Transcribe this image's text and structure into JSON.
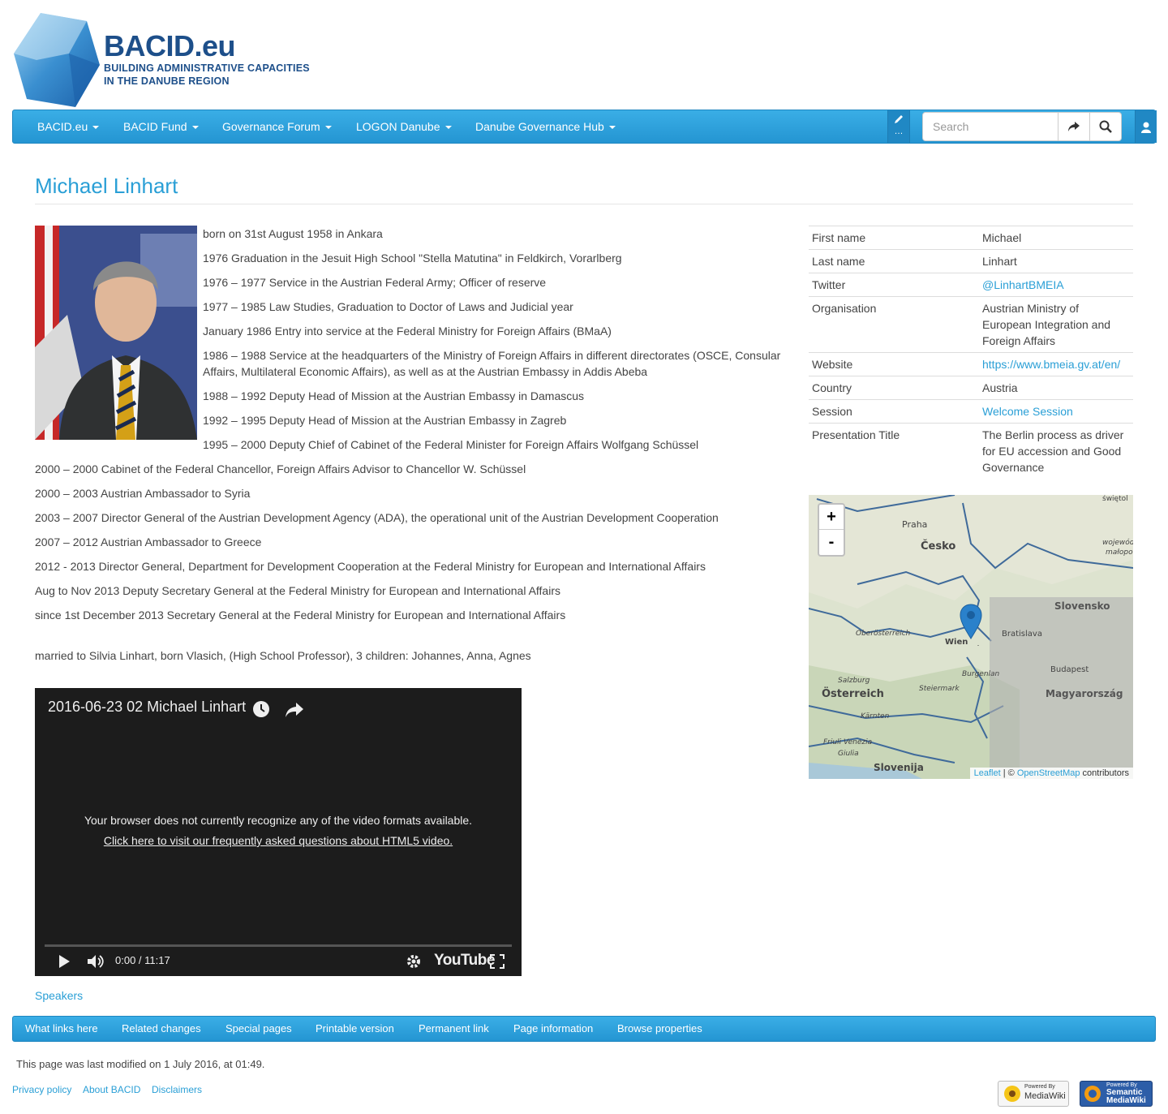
{
  "logo": {
    "brand": "BACID.eu",
    "tagline_1": "BUILDING ADMINISTRATIVE CAPACITIES",
    "tagline_2": "IN THE DANUBE REGION"
  },
  "nav": {
    "items": [
      {
        "label": "BACID.eu"
      },
      {
        "label": "BACID Fund"
      },
      {
        "label": "Governance Forum"
      },
      {
        "label": "LOGON Danube"
      },
      {
        "label": "Danube Governance Hub"
      }
    ],
    "edit_more": "…",
    "search_placeholder": "Search"
  },
  "page": {
    "title": "Michael Linhart"
  },
  "bio": [
    "born on 31st August 1958 in Ankara",
    "1976 Graduation in the Jesuit High School \"Stella Matutina\" in Feldkirch, Vorarlberg",
    "1976 – 1977 Service in the Austrian Federal Army; Officer of reserve",
    "1977 – 1985 Law Studies, Graduation to Doctor of Laws and Judicial year",
    "January 1986 Entry into service at the Federal Ministry for Foreign Affairs (BMaA)",
    "1986 – 1988 Service at the headquarters of the Ministry of Foreign Affairs in different directorates (OSCE, Consular Affairs, Multilateral Economic Affairs), as well as at the Austrian Embassy in Addis Abeba",
    "1988 – 1992 Deputy Head of Mission at the Austrian Embassy in Damascus",
    "1992 – 1995 Deputy Head of Mission at the Austrian Embassy in Zagreb",
    "1995 – 2000 Deputy Chief of Cabinet of the Federal Minister for Foreign Affairs Wolfgang Schüssel",
    "2000 – 2000 Cabinet of the Federal Chancellor, Foreign Affairs Advisor to Chancellor W. Schüssel",
    "2000 – 2003 Austrian Ambassador to Syria",
    "2003 – 2007 Director General of the Austrian Development Agency (ADA), the operational unit of the Austrian Development Cooperation",
    "2007 – 2012 Austrian Ambassador to Greece",
    "2012 - 2013 Director General, Department for Development Cooperation at the Federal Ministry for European and International Affairs",
    "Aug to Nov 2013 Deputy Secretary General at the Federal Ministry for European and International Affairs",
    "since 1st December 2013 Secretary General at the Federal Ministry for European and International Affairs",
    "married to Silvia Linhart, born Vlasich, (High School Professor), 3 children: Johannes, Anna, Agnes"
  ],
  "infobox": {
    "first_name_label": "First name",
    "first_name": "Michael",
    "last_name_label": "Last name",
    "last_name": "Linhart",
    "twitter_label": "Twitter",
    "twitter": "@LinhartBMEIA",
    "organisation_label": "Organisation",
    "organisation": "Austrian Ministry of European Integration and Foreign Affairs",
    "website_label": "Website",
    "website": "https://www.bmeia.gv.at/en/",
    "country_label": "Country",
    "country": "Austria",
    "session_label": "Session",
    "session": "Welcome Session",
    "presentation_label": "Presentation Title",
    "presentation": "The Berlin process as driver for EU accession and Good Governance"
  },
  "map": {
    "zoom_in": "+",
    "zoom_out": "-",
    "labels": {
      "praha": "Praha",
      "cesko": "Česko",
      "slovensko": "Slovensko",
      "bratislava": "Bratislava",
      "wien": "Wien",
      "oberosterreich": "Oberösterreich",
      "salzburg": "Salzburg",
      "osterreich": "Österreich",
      "steiermark": "Steiermark",
      "burgenland": "Burgenlan",
      "budapest": "Budapest",
      "magyarorszag": "Magyarország",
      "karnten": "Kärnten",
      "friuli": "Friuli Venezia",
      "giulia": "Giulia",
      "slovenija": "Slovenija",
      "swieto": "świętol",
      "wojewodz": "województ",
      "malopolsk": "małopolsk"
    },
    "attribution": {
      "leaflet": "Leaflet",
      "sep": " | © ",
      "osm": "OpenStreetMap",
      "rest": " contributors"
    }
  },
  "video": {
    "title": "2016-06-23 02 Michael Linhart",
    "message": "Your browser does not currently recognize any of the video formats available.",
    "faq_link": "Click here to visit our frequently asked questions about HTML5 video.",
    "time": "0:00 / 11:17",
    "brand": "YouTube"
  },
  "category": "Speakers",
  "footer": {
    "links": [
      {
        "label": "What links here"
      },
      {
        "label": "Related changes"
      },
      {
        "label": "Special pages"
      },
      {
        "label": "Printable version"
      },
      {
        "label": "Permanent link"
      },
      {
        "label": "Page information"
      },
      {
        "label": "Browse properties"
      }
    ],
    "modified": "This page was last modified on 1 July 2016, at 01:49.",
    "privacy": "Privacy policy",
    "about": "About BACID",
    "disclaimers": "Disclaimers",
    "badge_mw_1": "Powered By",
    "badge_mw_2": "MediaWiki",
    "badge_smw_1": "Powered By",
    "badge_smw_2": "Semantic",
    "badge_smw_3": "MediaWiki"
  },
  "colors": {
    "accent": "#2a9fd6",
    "navbar": "#2a9fd6",
    "text": "#444444"
  }
}
